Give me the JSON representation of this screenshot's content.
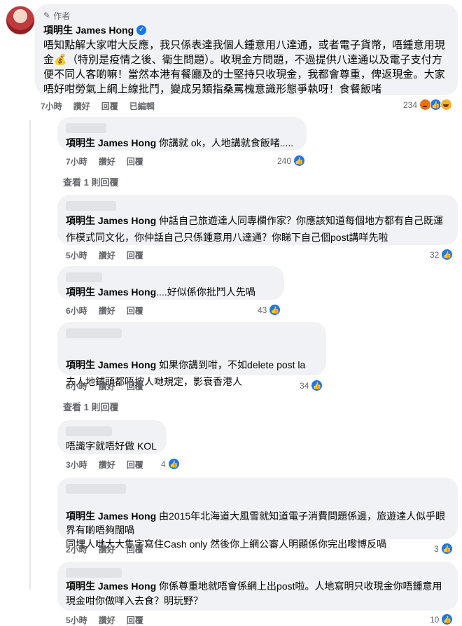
{
  "post": {
    "author_tag": "作者",
    "author_name": "項明生 James Hong",
    "text": "唔知點解大家咁大反應，我只係表達我個人鍾意用八達通，或者電子貨幣，唔鍾意用現金💰（特別是疫情之後、衛生問題）。收現金方問題，不過提供八達通以及電子支付方便不同人客啲嘛！當然本港有餐廳及的士堅持只收現金，我都會尊重，俾返現金。大家唔好咁勞氣上網上線批鬥，變成另類指桑罵槐意識形態爭執呀！食餐飯啫",
    "time": "7小時",
    "like_label": "讚好",
    "reply_label": "回覆",
    "edited_label": "已編輯",
    "reaction_count": "234"
  },
  "replies": [
    {
      "text": "你講就 ok，人地講就食飯啫.....",
      "mention": "項明生 James Hong",
      "time": "7小時",
      "like": "讚好",
      "reply": "回覆",
      "count": "240"
    },
    {
      "text": "仲話自己旅遊達人同專欄作家？你應該知道每個地方都有自己既運作模式同文化，你仲話自己只係鍾意用八達通？你睇下自己個post講咩先啦",
      "mention": "項明生 James Hong",
      "time": "5小時",
      "like": "讚好",
      "reply": "回覆",
      "count": "32"
    },
    {
      "text": "....好似係你批鬥人先喎",
      "mention": "項明生 James Hong",
      "time": "6小時",
      "like": "讚好",
      "reply": "回覆",
      "count": "43"
    },
    {
      "text": "如果你講到咁，不如delete post la\n去人地鋪頭都唔按人哋規定，影衰香港人",
      "mention": "項明生 James Hong",
      "time": "6小時",
      "like": "讚好",
      "reply": "回覆",
      "count": "34"
    },
    {
      "text": "唔識字就唔好做 KOL",
      "mention": "",
      "time": "3小時",
      "like": "讚好",
      "reply": "回覆",
      "count": "4"
    },
    {
      "text": "由2015年北海道大風雪就知道電子消費問題係邊，旅遊達人似乎眼界有啲唔夠闊喎\n同埋人哋大大隻字寫住Cash only 然後你上網公審人明顯係你完出嚟博反喎",
      "mention": "項明生 James Hong",
      "time": "2小時",
      "like": "讚好",
      "reply": "回覆",
      "count": "3"
    },
    {
      "text": "你係尊重地就唔會係網上出post啦。人地寫明只收現金你唔鍾意用現金咁你做咩入去食？明玩野？",
      "mention": "項明生 James Hong",
      "time": "5小時",
      "like": "讚好",
      "reply": "回覆",
      "count": "10"
    }
  ],
  "see_more_1": "查看 1 則回覆",
  "see_more_2": "查看 1 則回覆",
  "icons": [
    "pen-icon",
    "verified-icon",
    "angry-reaction-icon",
    "like-reaction-icon",
    "haha-reaction-icon"
  ],
  "colors": {
    "bubble": "#f0f2f5",
    "meta": "#65676b",
    "like": "#1877f2"
  }
}
